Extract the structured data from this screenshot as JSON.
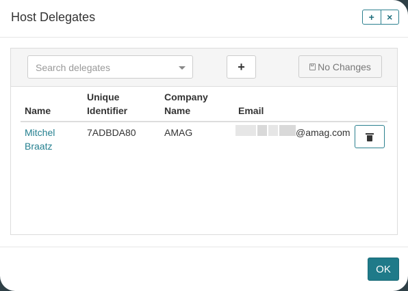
{
  "dialog": {
    "title": "Host Delegates",
    "header_buttons": {
      "add_symbol": "+",
      "close_symbol": "×"
    },
    "ok_label": "OK"
  },
  "toolbar": {
    "search_placeholder": "Search delegates",
    "add_symbol": "+",
    "no_changes_label": "No Changes",
    "no_changes_icon": "floppy-disk-icon"
  },
  "table": {
    "columns": {
      "name": "Name",
      "unique_identifier_1": "Unique",
      "unique_identifier_2": "Identifier",
      "company_1": "Company",
      "company_2": "Name",
      "email": "Email"
    },
    "rows": [
      {
        "name_line1": "Mitchel",
        "name_line2": "Braatz",
        "unique_identifier": "7ADBDA80",
        "company": "AMAG",
        "email_domain": "@amag.com",
        "delete_icon": "trash-icon"
      }
    ]
  },
  "colors": {
    "accent": "#1f7a89",
    "link": "#237f8f"
  }
}
